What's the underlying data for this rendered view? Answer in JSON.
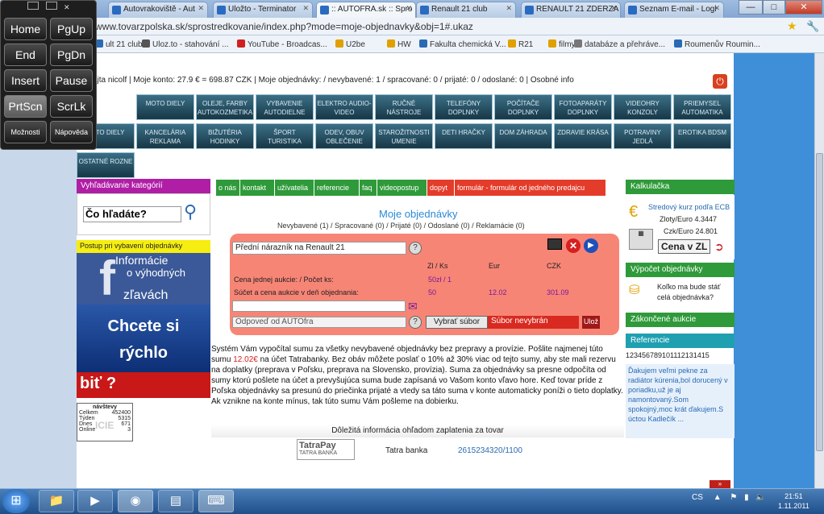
{
  "browser": {
    "tabs": [
      "Autovrakoviště - Aut",
      "Uložto - Terminator",
      ":: AUTOFRA.sk :: Spro",
      "Renault 21 club",
      "RENAULT 21 ZDERZA",
      "Seznam E-mail - Logi"
    ],
    "url": "www.tovarzpolska.sk/sprostredkovanie/index.php?mode=moje-objednavky&obj=1#.ukaz",
    "bookmarks": [
      "ult 21 club",
      "Uloz.to - stahování ...",
      "YouTube - Broadcas...",
      "U2be",
      "HW",
      "Fakulta chemická V...",
      "R21",
      "filmy",
      "databáze a přehráve...",
      "Roumenův Roumin..."
    ],
    "window_buttons": [
      "—",
      "□",
      "✕"
    ]
  },
  "account_bar": "ajta nicolf | Moje konto: 27.9 € = 698.87 CZK | Moje objednávky: / nevybavené: 1 / spracované: 0 / prijaté: 0 / odoslané: 0 | Osobné info",
  "categories": [
    [
      "MOTO DIELY",
      "OLEJE, FARBY AUTOKOZMETIKA",
      "VYBAVENIE AUTODIELNE",
      "ELEKTRO AUDIO-VIDEO",
      "RUČNÉ NÁSTROJE",
      "TELEFÓNY DOPLNKY",
      "POČÍTAČE DOPLNKY",
      "FOTOAPARÁTY DOPLNKY",
      "VIDEOHRY KONZOLY",
      "PRIEMYSEL AUTOMATIKA"
    ],
    [
      "AUTO DIELY",
      "KANCELÁRIA REKLAMA",
      "BIŽUTÉRIA HODINKY",
      "ŠPORT TURISTIKA",
      "ODEV, OBUV OBLEČENIE",
      "STAROŽITNOSTI UMENIE",
      "DETI HRAČKY",
      "DOM ZÁHRADA",
      "ZDRAVIE KRÁSA",
      "POTRAVINY JEDLÁ",
      "EROTIKA BDSM"
    ],
    [
      "OSTATNÉ ROZNE"
    ]
  ],
  "left": {
    "header": "Vyhľadávanie kategórií",
    "search_value": "Čo hľadáte?",
    "yellow": "Postup pri vybavení objednávky",
    "fb_lines": [
      "Informácie",
      "o výhodných",
      "zľavách"
    ],
    "blue_lines": [
      "Chcete si",
      "rýchlo"
    ],
    "red": "biť ?",
    "counter": {
      "title": "návštevy",
      "rows": [
        [
          "Celkem",
          "452400"
        ],
        [
          "Týden",
          "5315"
        ],
        [
          "Dnes",
          "671"
        ],
        [
          "Online",
          "3"
        ]
      ],
      "brand": "ICIE"
    }
  },
  "nav_tabs": [
    {
      "label": "o nás",
      "red": false
    },
    {
      "label": "kontakt",
      "red": false
    },
    {
      "label": "užívatelia",
      "red": false
    },
    {
      "label": "referencie",
      "red": false
    },
    {
      "label": "faq",
      "red": false
    },
    {
      "label": "videopostup",
      "red": false
    },
    {
      "label": "dopyt",
      "red": true
    },
    {
      "label": "formulár - formulár od jedného predajcu",
      "red": true
    }
  ],
  "order": {
    "title": "Moje objednávky",
    "subtitle": "Nevybavené (1) / Spracované (0) / Prijaté (0) / Odoslané (0) / Reklamácie (0)",
    "product": "Přední nárazník na Renault 21",
    "col_headers": [
      "Zl / Ks",
      "Eur",
      "CZK"
    ],
    "row1_label": "Cena jednej aukcie: / Počet ks:",
    "row1_value": "50zł / 1",
    "row2_label": "Súčet a cena aukcie v deň objednania:",
    "row2_values": [
      "50",
      "12.02",
      "301.09"
    ],
    "reply": "Odpoveď od AUTOfra",
    "choose_file": "Vybrať súbor",
    "no_file": "Súbor nevybrán",
    "save": "Ulož",
    "body_before": "Systém Vám vypočítal sumu za všetky nevybavené objednávky bez prepravy a provízie. Pošlite najmenej túto sumu ",
    "body_amount": "12.02€",
    "body_after": " na účet Tatrabanky. Bez obáv môžete poslať o 10% až 30% viac od tejto sumy, aby ste mali rezervu na doplatky (preprava v Poľsku, preprava na Slovensko, provízia). Suma za objednávky sa presne odpočíta od sumy ktorú pošlete na účet a prevyšujúca suma bude zapísaná vo Vašom konto vľavo hore. Keď tovar príde z Poľska objednávky sa presunú do priečinka prijaté a vtedy sa táto suma v konte automaticky poníži o tieto doplatky. Ak vznikne na konte mínus, tak túto sumu Vám pošleme na dobierku.",
    "pay_header": "Dôležitá informácia ohľadom zaplatenia za tovar",
    "bank_logo": [
      "TatraPay",
      "TATRA BANKA"
    ],
    "bank_name": "Tatra banka",
    "account": "2615234320/1100"
  },
  "right": {
    "calc_header": "Kalkulačka",
    "rate_title": "Stredový kurz podľa ECB",
    "rate1": "Zloty/Euro 4.3447",
    "rate2": "Czk/Euro 24.801",
    "cena_btn": "Cena v ZL",
    "calc_order_header": "Výpočet objednávky",
    "calc_order_text": "Koľko ma bude stáť celá objednávka?",
    "zakon_header": "Zákončené aukcie",
    "ref_header": "Referencie",
    "ref_numbers": "123456789101112131415",
    "ref_text": "Ďakujem veľmi pekne za radiátor kúrenia,bol dorucený v poriadku,už je aj namontovaný.Som spokojný,moc krát ďakujem.S úctou Kadlečík ..."
  },
  "keypad": {
    "keys": [
      [
        "Home",
        "PgUp"
      ],
      [
        "End",
        "PgDn"
      ],
      [
        "Insert",
        "Pause"
      ],
      [
        "PrtScn",
        "ScrLk"
      ],
      [
        "Možnosti",
        "Nápověda"
      ]
    ],
    "selected": "PrtScn"
  },
  "taskbar": {
    "lang": "CS",
    "time": "21:51",
    "date": "1.11.2011"
  },
  "colors": {
    "accent": "#2a8ad6",
    "nav_green": "#2f9a3a",
    "nav_red": "#e43c2a",
    "panel": "#f78576"
  }
}
